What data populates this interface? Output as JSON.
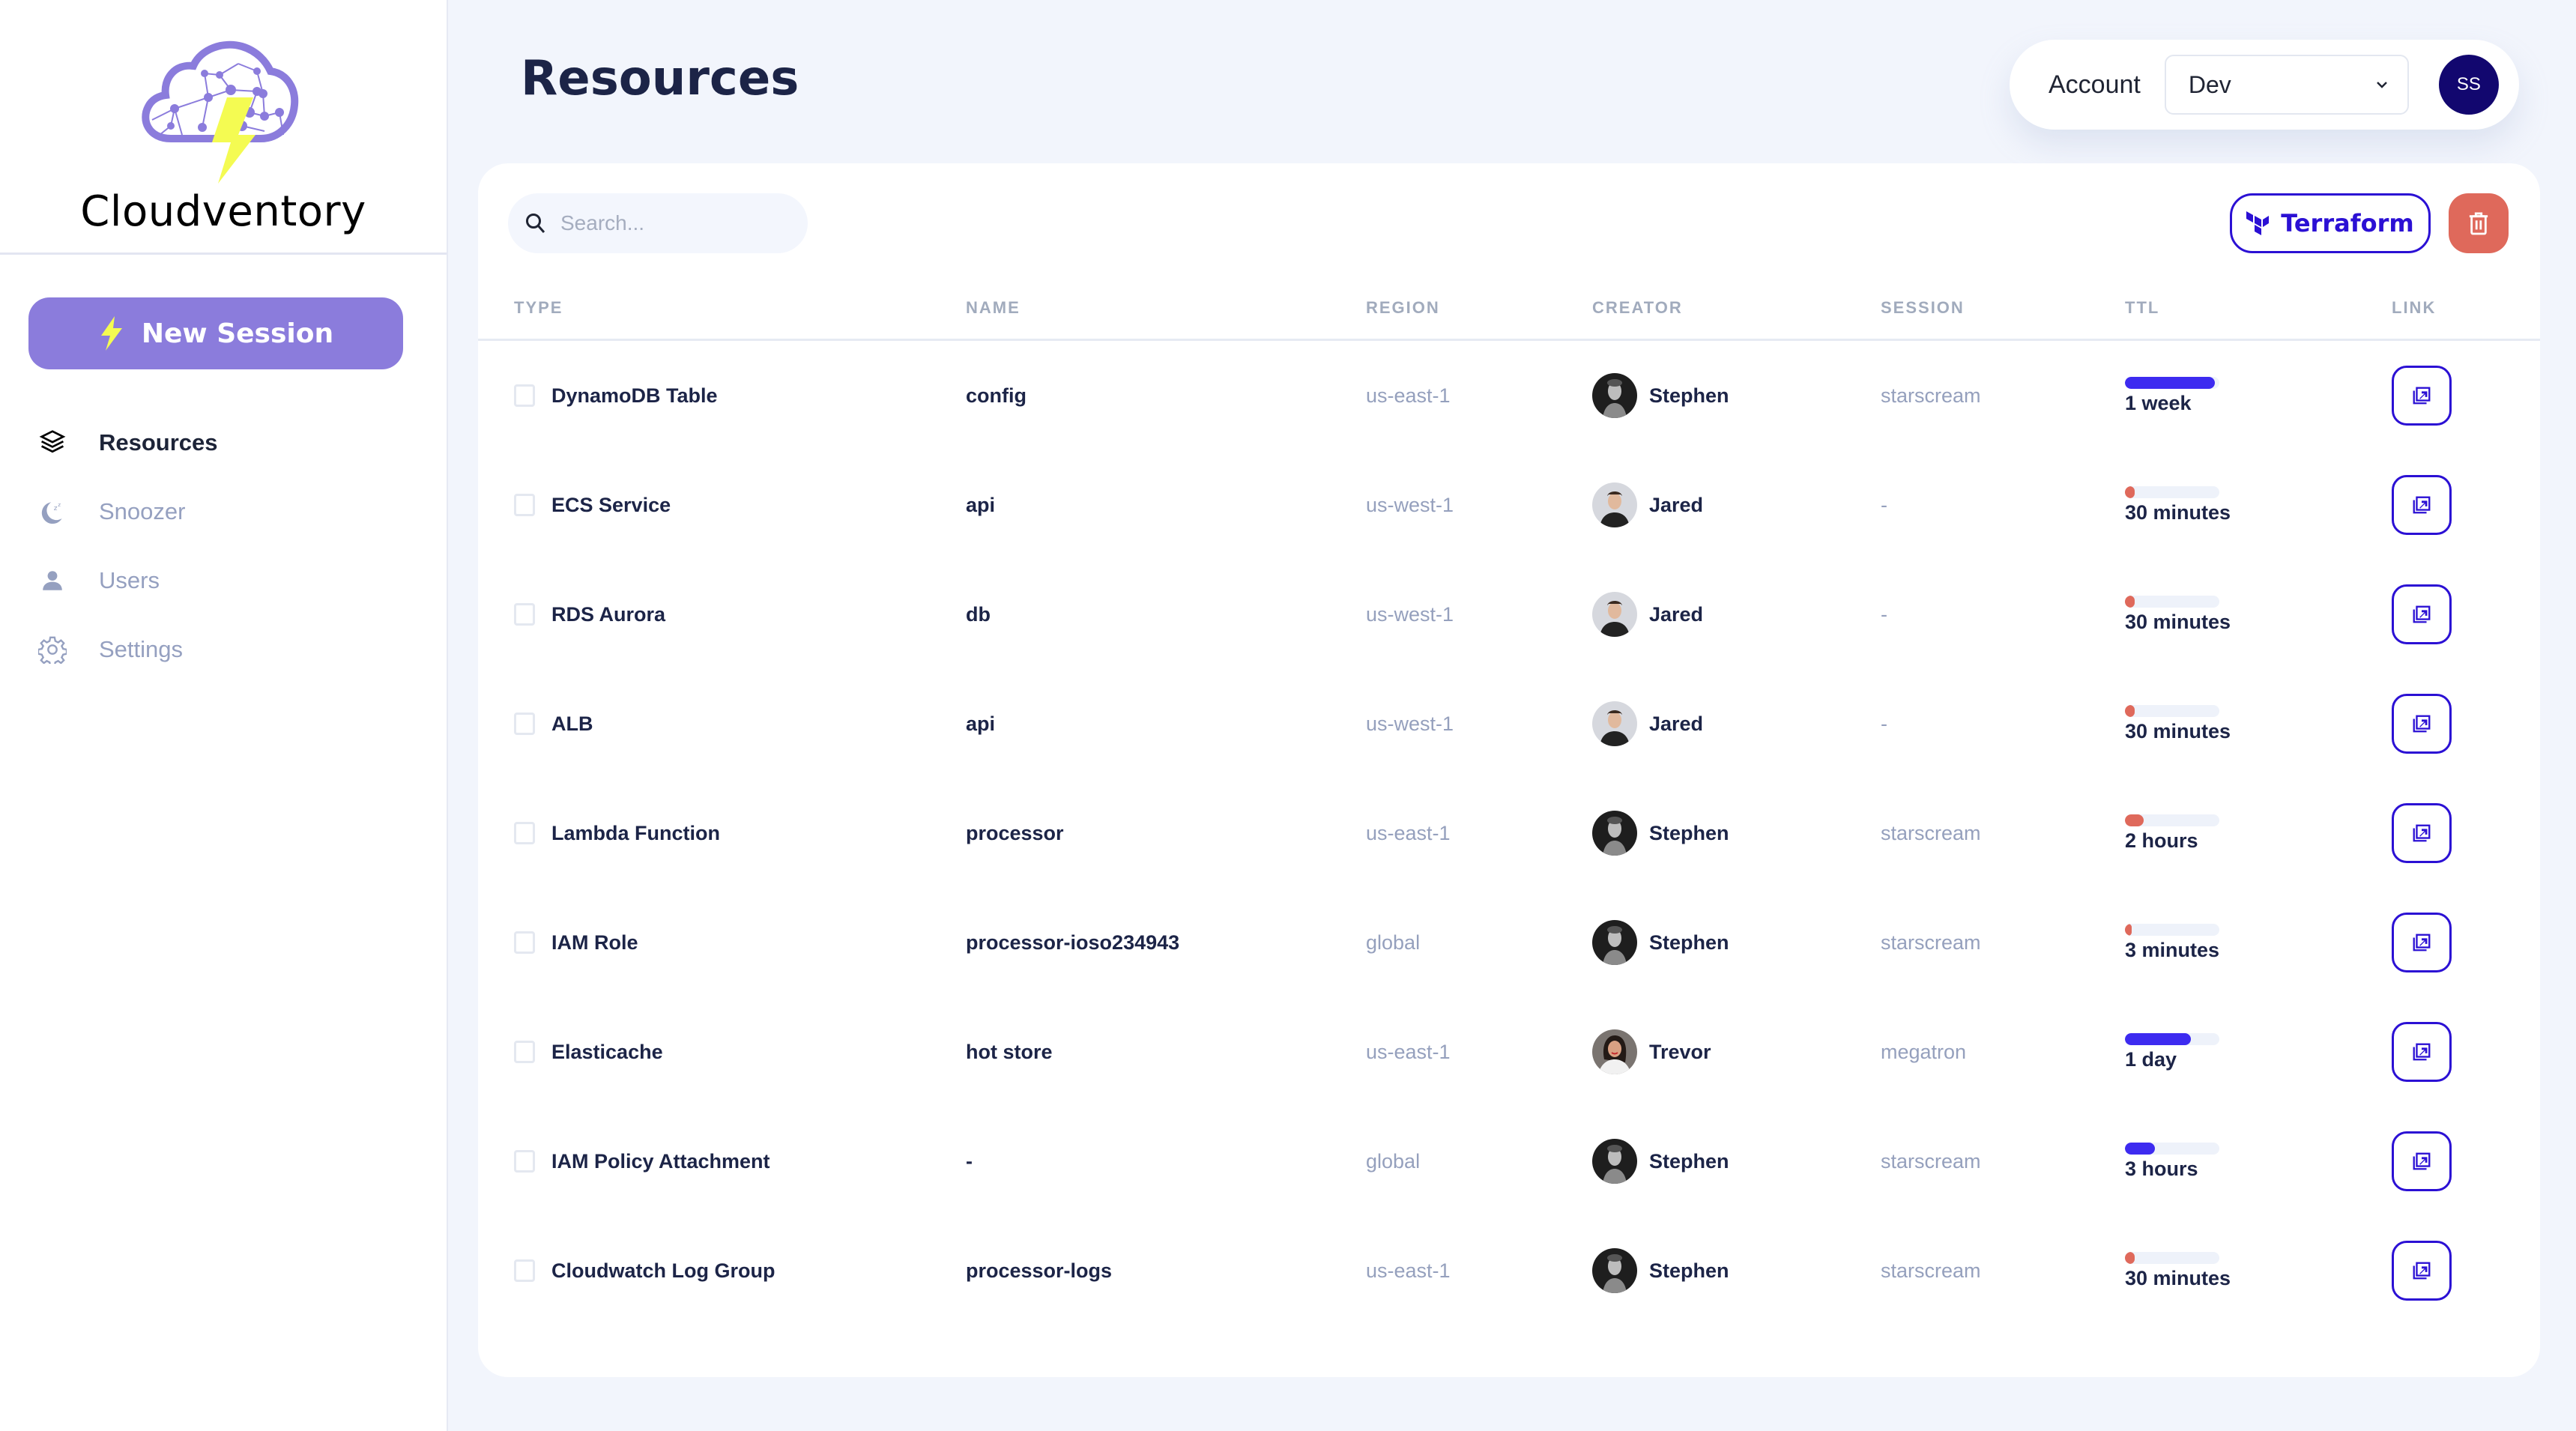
{
  "app": {
    "brand": "Cloudventory"
  },
  "sidebar": {
    "new_session_label": "New Session",
    "items": [
      {
        "label": "Resources",
        "icon": "layers-icon",
        "active": true
      },
      {
        "label": "Snoozer",
        "icon": "moon-sleep-icon",
        "active": false
      },
      {
        "label": "Users",
        "icon": "user-icon",
        "active": false
      },
      {
        "label": "Settings",
        "icon": "gear-icon",
        "active": false
      }
    ]
  },
  "header": {
    "title": "Resources",
    "account_label": "Account",
    "account_selected": "Dev",
    "user_initials": "SS"
  },
  "toolbar": {
    "search_placeholder": "Search...",
    "search_value": "",
    "terraform_label": "Terraform",
    "delete_icon": "trash-icon"
  },
  "colors": {
    "accent": "#8b7cdc",
    "primary": "#2b10d4",
    "ttl_long": "#3d2bf0",
    "ttl_short": "#df695b",
    "danger": "#df695b",
    "avatar_bg": "#12076f"
  },
  "table": {
    "columns": [
      "TYPE",
      "NAME",
      "REGION",
      "CREATOR",
      "SESSION",
      "TTL",
      "LINK"
    ],
    "rows": [
      {
        "type": "DynamoDB Table",
        "name": "config",
        "region": "us-east-1",
        "creator": "Stephen",
        "session": "starscream",
        "ttl": "1 week",
        "ttl_fraction": 0.95,
        "ttl_status": "long"
      },
      {
        "type": "ECS Service",
        "name": "api",
        "region": "us-west-1",
        "creator": "Jared",
        "session": "-",
        "ttl": "30 minutes",
        "ttl_fraction": 0.1,
        "ttl_status": "short"
      },
      {
        "type": "RDS Aurora",
        "name": "db",
        "region": "us-west-1",
        "creator": "Jared",
        "session": "-",
        "ttl": "30 minutes",
        "ttl_fraction": 0.1,
        "ttl_status": "short"
      },
      {
        "type": "ALB",
        "name": "api",
        "region": "us-west-1",
        "creator": "Jared",
        "session": "-",
        "ttl": "30 minutes",
        "ttl_fraction": 0.1,
        "ttl_status": "short"
      },
      {
        "type": "Lambda Function",
        "name": "processor",
        "region": "us-east-1",
        "creator": "Stephen",
        "session": "starscream",
        "ttl": "2 hours",
        "ttl_fraction": 0.2,
        "ttl_status": "short"
      },
      {
        "type": "IAM Role",
        "name": "processor-ioso234943",
        "region": "global",
        "creator": "Stephen",
        "session": "starscream",
        "ttl": "3 minutes",
        "ttl_fraction": 0.07,
        "ttl_status": "short"
      },
      {
        "type": "Elasticache",
        "name": "hot store",
        "region": "us-east-1",
        "creator": "Trevor",
        "session": "megatron",
        "ttl": "1 day",
        "ttl_fraction": 0.7,
        "ttl_status": "long"
      },
      {
        "type": "IAM Policy Attachment",
        "name": "-",
        "region": "global",
        "creator": "Stephen",
        "session": "starscream",
        "ttl": "3 hours",
        "ttl_fraction": 0.32,
        "ttl_status": "long"
      },
      {
        "type": "Cloudwatch Log Group",
        "name": "processor-logs",
        "region": "us-east-1",
        "creator": "Stephen",
        "session": "starscream",
        "ttl": "30 minutes",
        "ttl_fraction": 0.1,
        "ttl_status": "short"
      }
    ]
  }
}
